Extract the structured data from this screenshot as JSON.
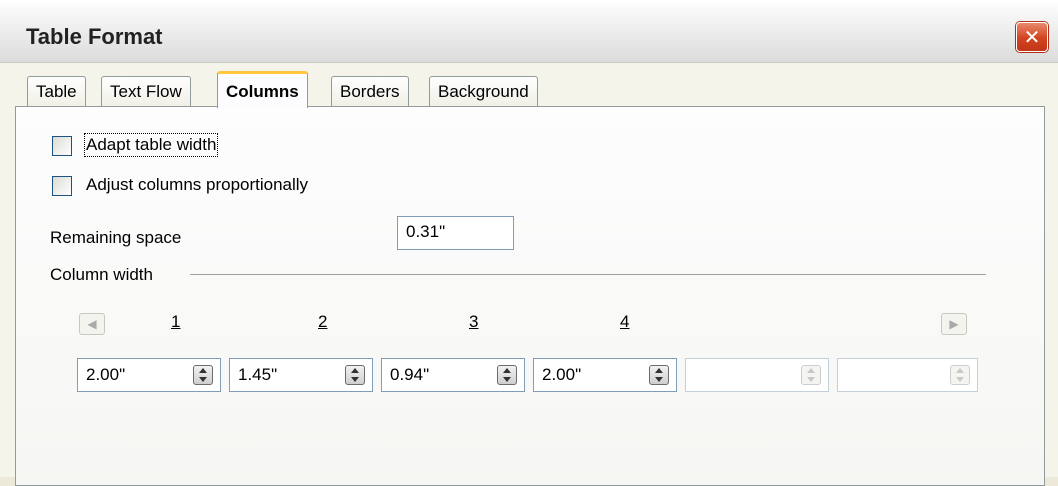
{
  "window": {
    "title": "Table Format",
    "close_icon": "close-icon"
  },
  "tabs": [
    {
      "label": "Table",
      "active": false
    },
    {
      "label": "Text Flow",
      "active": false
    },
    {
      "label": "Columns",
      "active": true
    },
    {
      "label": "Borders",
      "active": false
    },
    {
      "label": "Background",
      "active": false
    }
  ],
  "options": {
    "adapt_table_width": {
      "label": "Adapt table width",
      "checked": false
    },
    "adjust_columns": {
      "label": "Adjust columns proportionally",
      "checked": false
    }
  },
  "remaining_space": {
    "label": "Remaining space",
    "value": "0.31\""
  },
  "column_width": {
    "heading": "Column width",
    "columns": [
      {
        "number": "1",
        "value": "2.00\""
      },
      {
        "number": "2",
        "value": "1.45\""
      },
      {
        "number": "3",
        "value": "0.94\""
      },
      {
        "number": "4",
        "value": "2.00\""
      },
      {
        "number": "",
        "value": ""
      },
      {
        "number": "",
        "value": ""
      }
    ]
  },
  "colors": {
    "accent_tab": "#ffc83c",
    "close": "#d3431f",
    "input_border": "#7f9db9"
  }
}
